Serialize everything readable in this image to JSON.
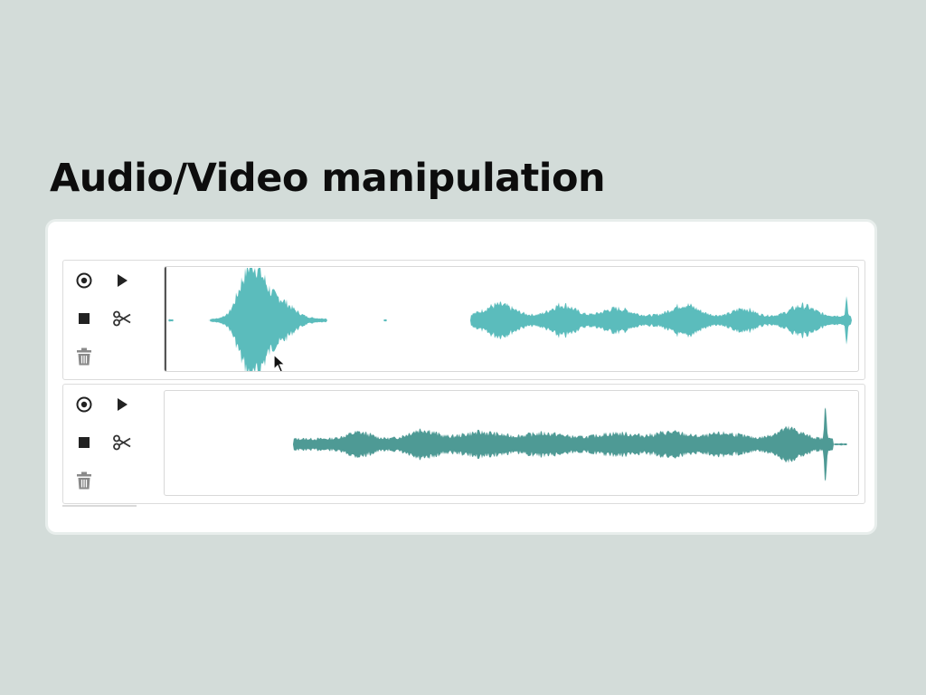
{
  "title": "Audio/Video manipulation",
  "tracks": [
    {
      "controls": [
        "record-icon",
        "play-icon",
        "stop-icon",
        "scissors-icon",
        "trash-icon"
      ],
      "waveform_color": "#5bbcbc",
      "has_playhead": true
    },
    {
      "controls": [
        "record-icon",
        "play-icon",
        "stop-icon",
        "scissors-icon",
        "trash-icon"
      ],
      "waveform_color": "#4e9a95",
      "has_playhead": false
    }
  ],
  "colors": {
    "background": "#d3dcd9",
    "panel": "#ffffff",
    "icon": "#222222",
    "trash_icon": "#8a8a8a"
  }
}
